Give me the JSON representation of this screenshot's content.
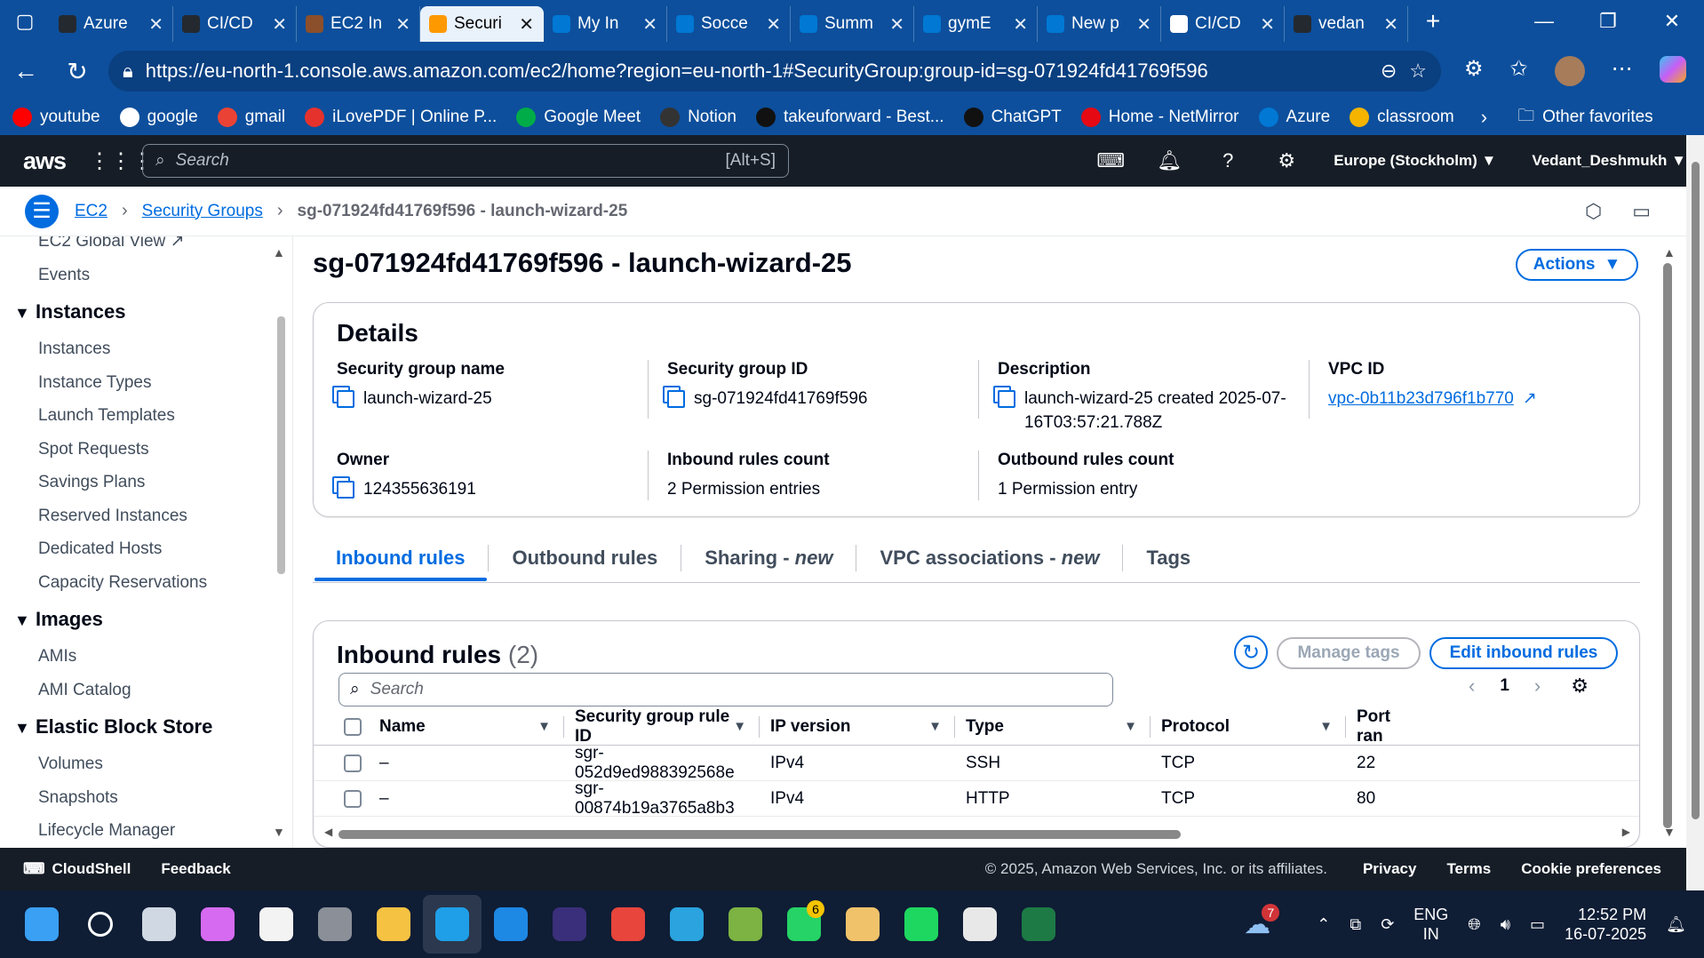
{
  "browser": {
    "tabs": [
      {
        "label": "Azure",
        "icon": "github-icon",
        "color": "#24292f"
      },
      {
        "label": "CI/CD",
        "icon": "github-icon",
        "color": "#24292f"
      },
      {
        "label": "EC2 In",
        "icon": "ec2-icon",
        "color": "#8c4f2b"
      },
      {
        "label": "Securi",
        "icon": "aws-icon",
        "color": "#ff9900"
      },
      {
        "label": "My In",
        "icon": "azure-icon",
        "color": "#0078d4"
      },
      {
        "label": "Socce",
        "icon": "azure-icon",
        "color": "#0078d4"
      },
      {
        "label": "Summ",
        "icon": "azure-icon",
        "color": "#0078d4"
      },
      {
        "label": "gymE",
        "icon": "azure-icon",
        "color": "#0078d4"
      },
      {
        "label": "New p",
        "icon": "azure-icon",
        "color": "#0078d4"
      },
      {
        "label": "CI/CD",
        "icon": "notion-icon",
        "color": "#ffffff"
      },
      {
        "label": "vedan",
        "icon": "github-icon",
        "color": "#24292f"
      }
    ],
    "url": "https://eu-north-1.console.aws.amazon.com/ec2/home?region=eu-north-1#SecurityGroup:group-id=sg-071924fd41769f596",
    "bookmarks": [
      {
        "label": "youtube",
        "color": "#ff0000"
      },
      {
        "label": "google",
        "color": "#ffffff"
      },
      {
        "label": "gmail",
        "color": "#ea4335"
      },
      {
        "label": "iLovePDF | Online P...",
        "color": "#e5322d"
      },
      {
        "label": "Google Meet",
        "color": "#00ac47"
      },
      {
        "label": "Notion",
        "color": "#333333"
      },
      {
        "label": "takeuforward - Best...",
        "color": "#111111"
      },
      {
        "label": "ChatGPT",
        "color": "#111111"
      },
      {
        "label": "Home - NetMirror",
        "color": "#e50914"
      },
      {
        "label": "Azure",
        "color": "#0078d4"
      },
      {
        "label": "classroom",
        "color": "#f4b400"
      }
    ],
    "other_favorites": "Other favorites"
  },
  "aws": {
    "search_placeholder": "Search",
    "search_shortcut": "[Alt+S]",
    "region": "Europe (Stockholm)",
    "user": "Vedant_Deshmukh"
  },
  "breadcrumb": {
    "root": "EC2",
    "section": "Security Groups",
    "current": "sg-071924fd41769f596 - launch-wizard-25"
  },
  "sidebar": {
    "top_items": [
      "EC2 Global View",
      "Events"
    ],
    "groups": [
      {
        "title": "Instances",
        "items": [
          "Instances",
          "Instance Types",
          "Launch Templates",
          "Spot Requests",
          "Savings Plans",
          "Reserved Instances",
          "Dedicated Hosts",
          "Capacity Reservations"
        ]
      },
      {
        "title": "Images",
        "items": [
          "AMIs",
          "AMI Catalog"
        ]
      },
      {
        "title": "Elastic Block Store",
        "items": [
          "Volumes",
          "Snapshots",
          "Lifecycle Manager"
        ]
      }
    ]
  },
  "page": {
    "title": "sg-071924fd41769f596 - launch-wizard-25",
    "actions": "Actions"
  },
  "details": {
    "heading": "Details",
    "sg_name_label": "Security group name",
    "sg_name": "launch-wizard-25",
    "sg_id_label": "Security group ID",
    "sg_id": "sg-071924fd41769f596",
    "desc_label": "Description",
    "desc": "launch-wizard-25 created 2025-07-16T03:57:21.788Z",
    "vpc_label": "VPC ID",
    "vpc": "vpc-0b11b23d796f1b770",
    "owner_label": "Owner",
    "owner": "124355636191",
    "inbound_count_label": "Inbound rules count",
    "inbound_count": "2 Permission entries",
    "outbound_count_label": "Outbound rules count",
    "outbound_count": "1 Permission entry"
  },
  "tabs": {
    "inbound": "Inbound rules",
    "outbound": "Outbound rules",
    "sharing": "Sharing - ",
    "sharing_new": "new",
    "vpc_assoc": "VPC associations - ",
    "vpc_new": "new",
    "tags": "Tags"
  },
  "inbound": {
    "heading": "Inbound rules",
    "count": "(2)",
    "manage_tags": "Manage tags",
    "edit": "Edit inbound rules",
    "search_placeholder": "Search",
    "page": "1",
    "columns": [
      "Name",
      "Security group rule ID",
      "IP version",
      "Type",
      "Protocol",
      "Port ran"
    ],
    "rows": [
      [
        "–",
        "sgr-052d9ed988392568e",
        "IPv4",
        "SSH",
        "TCP",
        "22"
      ],
      [
        "–",
        "sgr-00874b19a3765a8b3",
        "IPv4",
        "HTTP",
        "TCP",
        "80"
      ]
    ]
  },
  "footer": {
    "cloudshell": "CloudShell",
    "feedback": "Feedback",
    "copyright": "© 2025, Amazon Web Services, Inc. or its affiliates.",
    "privacy": "Privacy",
    "terms": "Terms",
    "cookie": "Cookie preferences"
  },
  "taskbar": {
    "apps": [
      {
        "name": "start-icon",
        "color": "#3aa0f3"
      },
      {
        "name": "search-icon",
        "color": "#0f1d35"
      },
      {
        "name": "task-view-icon",
        "color": "#cfd8e3"
      },
      {
        "name": "copilot-icon",
        "color": "#d66af0"
      },
      {
        "name": "store-icon",
        "color": "#f3f3f3"
      },
      {
        "name": "camera-icon",
        "color": "#8a8f98"
      },
      {
        "name": "file-explorer-icon",
        "color": "#f5c242"
      },
      {
        "name": "edge-icon",
        "color": "#1f9fe8"
      },
      {
        "name": "vscode-icon",
        "color": "#1e88e5"
      },
      {
        "name": "eclipse-icon",
        "color": "#3a2f7a"
      },
      {
        "name": "chrome-icon",
        "color": "#e8453c"
      },
      {
        "name": "telegram-icon",
        "color": "#2aa3de"
      },
      {
        "name": "notepad-icon",
        "color": "#7cb342"
      },
      {
        "name": "whatsapp-icon",
        "color": "#25d366"
      },
      {
        "name": "app-icon",
        "color": "#f0c36a"
      },
      {
        "name": "spotify-icon",
        "color": "#1ed760"
      },
      {
        "name": "snipping-icon",
        "color": "#e8e8e8"
      },
      {
        "name": "excel-icon",
        "color": "#1d7a45"
      }
    ],
    "whatsapp_badge": "6",
    "weather_badge": "7",
    "lang1": "ENG",
    "lang2": "IN",
    "time": "12:52 PM",
    "date": "16-07-2025"
  }
}
